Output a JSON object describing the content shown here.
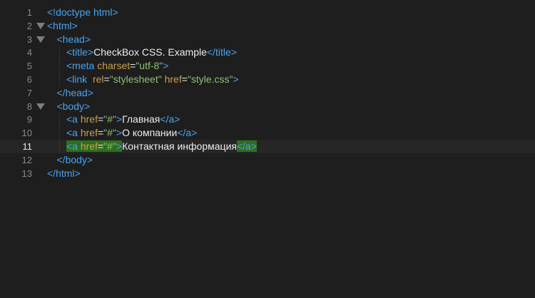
{
  "editor": {
    "lines": [
      {
        "num": "1",
        "fold": false,
        "current": false,
        "indent": 0,
        "tokens": [
          {
            "t": "tag",
            "v": "<!doctype html>"
          }
        ]
      },
      {
        "num": "2",
        "fold": true,
        "current": false,
        "indent": 0,
        "tokens": [
          {
            "t": "tag",
            "v": "<html>"
          }
        ]
      },
      {
        "num": "3",
        "fold": true,
        "current": false,
        "indent": 1,
        "tokens": [
          {
            "t": "tag",
            "v": "<head>"
          }
        ]
      },
      {
        "num": "4",
        "fold": false,
        "current": false,
        "indent": 2,
        "tokens": [
          {
            "t": "tag",
            "v": "<title>"
          },
          {
            "t": "txt",
            "v": "CheckBox CSS. Example"
          },
          {
            "t": "tag",
            "v": "</title>"
          }
        ]
      },
      {
        "num": "5",
        "fold": false,
        "current": false,
        "indent": 2,
        "tokens": [
          {
            "t": "tag",
            "v": "<meta "
          },
          {
            "t": "attr",
            "v": "charset"
          },
          {
            "t": "txt",
            "v": "="
          },
          {
            "t": "str",
            "v": "\"utf-8\""
          },
          {
            "t": "tag",
            "v": ">"
          }
        ]
      },
      {
        "num": "6",
        "fold": false,
        "current": false,
        "indent": 2,
        "tokens": [
          {
            "t": "tag",
            "v": "<link  "
          },
          {
            "t": "attr",
            "v": "rel"
          },
          {
            "t": "txt",
            "v": "="
          },
          {
            "t": "str",
            "v": "\"stylesheet\""
          },
          {
            "t": "txt",
            "v": " "
          },
          {
            "t": "attr",
            "v": "href"
          },
          {
            "t": "txt",
            "v": "="
          },
          {
            "t": "str",
            "v": "\"style.css\""
          },
          {
            "t": "tag",
            "v": ">"
          }
        ]
      },
      {
        "num": "7",
        "fold": false,
        "current": false,
        "indent": 1,
        "tokens": [
          {
            "t": "tag",
            "v": "</head>"
          }
        ]
      },
      {
        "num": "8",
        "fold": true,
        "current": false,
        "indent": 1,
        "tokens": [
          {
            "t": "tag",
            "v": "<body>"
          }
        ]
      },
      {
        "num": "9",
        "fold": false,
        "current": false,
        "indent": 2,
        "tokens": [
          {
            "t": "tag",
            "v": "<a "
          },
          {
            "t": "attr",
            "v": "href"
          },
          {
            "t": "txt",
            "v": "="
          },
          {
            "t": "str",
            "v": "\"#\""
          },
          {
            "t": "tag",
            "v": ">"
          },
          {
            "t": "txt",
            "v": "Главная"
          },
          {
            "t": "tag",
            "v": "</a>"
          }
        ]
      },
      {
        "num": "10",
        "fold": false,
        "current": false,
        "indent": 2,
        "tokens": [
          {
            "t": "tag",
            "v": "<a "
          },
          {
            "t": "attr",
            "v": "href"
          },
          {
            "t": "txt",
            "v": "="
          },
          {
            "t": "str",
            "v": "\"#\""
          },
          {
            "t": "tag",
            "v": ">"
          },
          {
            "t": "txt",
            "v": "О компании"
          },
          {
            "t": "tag",
            "v": "</a>"
          }
        ]
      },
      {
        "num": "11",
        "fold": false,
        "current": true,
        "indent": 2,
        "tokens": [
          {
            "t": "tag",
            "v": "<a ",
            "hl": true
          },
          {
            "t": "attr",
            "v": "href",
            "hl": true
          },
          {
            "t": "txt",
            "v": "=",
            "hl": true
          },
          {
            "t": "str",
            "v": "\"#\"",
            "hl": true
          },
          {
            "t": "tag",
            "v": ">",
            "hl": true
          },
          {
            "t": "txt",
            "v": "Контактная информация"
          },
          {
            "t": "tag",
            "v": "</a>",
            "hl": true
          }
        ]
      },
      {
        "num": "12",
        "fold": false,
        "current": false,
        "indent": 1,
        "tokens": [
          {
            "t": "tag",
            "v": "</body>"
          }
        ]
      },
      {
        "num": "13",
        "fold": false,
        "current": false,
        "indent": 0,
        "tokens": [
          {
            "t": "tag",
            "v": "</html>"
          }
        ]
      }
    ]
  },
  "colors": {
    "background": "#1e1e1e",
    "tag": "#4aa3f0",
    "attribute": "#c9a14a",
    "string": "#8dc26f",
    "text": "#ededed",
    "line_number": "#8a8a8a",
    "match_highlight": "#2f6d1f"
  },
  "icons": {
    "fold": "fold-arrow-icon"
  }
}
